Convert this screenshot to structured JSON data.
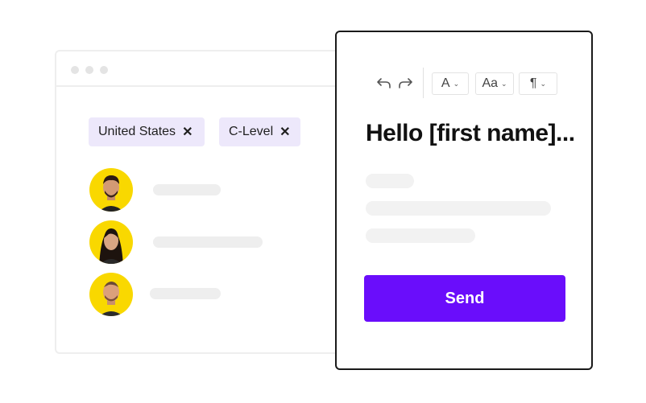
{
  "filters": {
    "tags": [
      {
        "label": "United States",
        "remove": "✕"
      },
      {
        "label": "C-Level",
        "remove": "✕"
      }
    ]
  },
  "colors": {
    "accent": "#6a0dfb",
    "tag_bg": "#ede8fb",
    "avatar_bg": "#f9d800",
    "skeleton": "#eeeeee"
  },
  "contacts": {
    "count_visible": 3
  },
  "editor": {
    "toolbar": {
      "undo_icon": "undo-icon",
      "redo_icon": "redo-icon",
      "font_color": "A",
      "font_size": "Aa",
      "paragraph": "¶"
    },
    "heading": "Hello [first name]...",
    "send_label": "Send"
  }
}
